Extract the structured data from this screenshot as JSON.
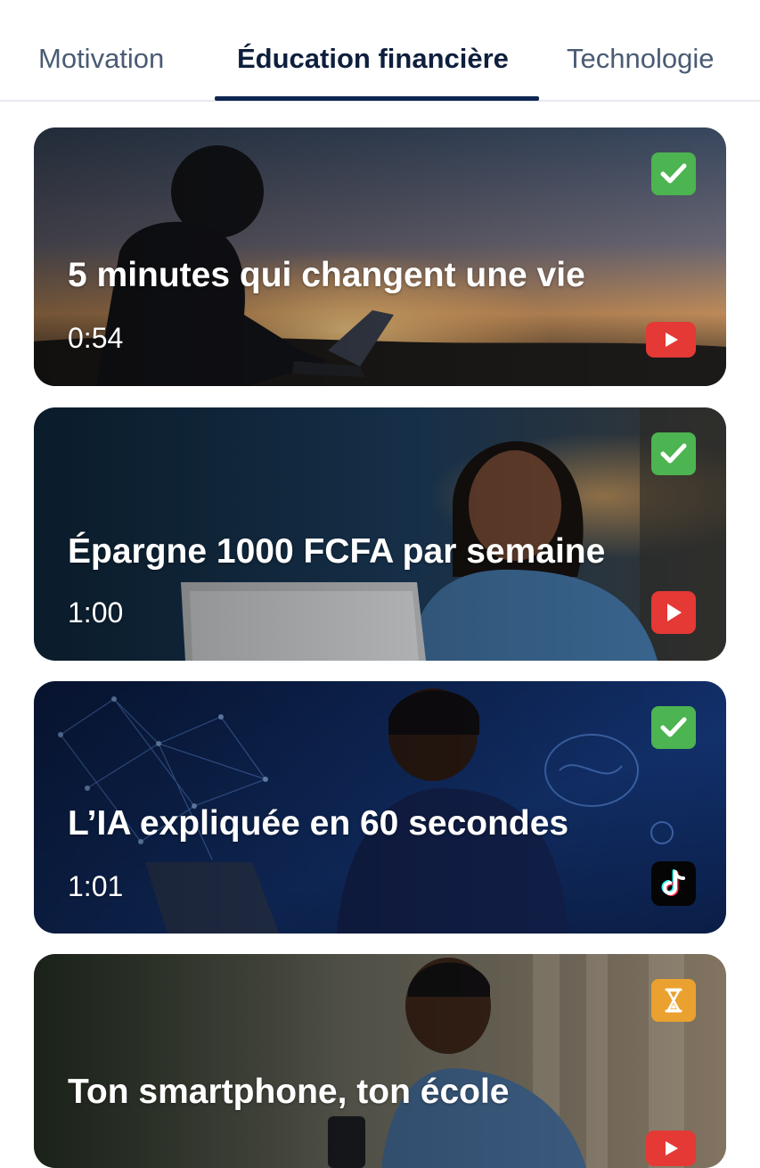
{
  "tabs": [
    {
      "label": "Motivation",
      "active": false
    },
    {
      "label": "Éducation financière",
      "active": true
    },
    {
      "label": "Technologie",
      "active": false
    }
  ],
  "videos": [
    {
      "title": "5 minutes qui changent une vie",
      "duration": "0:54",
      "status": "completed",
      "status_icon": "checkmark-icon",
      "platform": "youtube",
      "platform_icon": "youtube-icon"
    },
    {
      "title": "Épargne 1000 FCFA par semaine",
      "duration": "1:00",
      "status": "completed",
      "status_icon": "checkmark-icon",
      "platform": "youtube",
      "platform_icon": "youtube-icon"
    },
    {
      "title": "L’IA expliquée en 60 secondes",
      "duration": "1:01",
      "status": "completed",
      "status_icon": "checkmark-icon",
      "platform": "tiktok",
      "platform_icon": "tiktok-icon"
    },
    {
      "title": "Ton smartphone, ton école",
      "duration": "",
      "status": "pending",
      "status_icon": "hourglass-icon",
      "platform": "youtube",
      "platform_icon": "youtube-icon"
    }
  ],
  "colors": {
    "active_tab_underline": "#0f2552",
    "completed_badge": "#4cb450",
    "pending_badge": "#eaa12f",
    "youtube_red": "#e53935"
  }
}
